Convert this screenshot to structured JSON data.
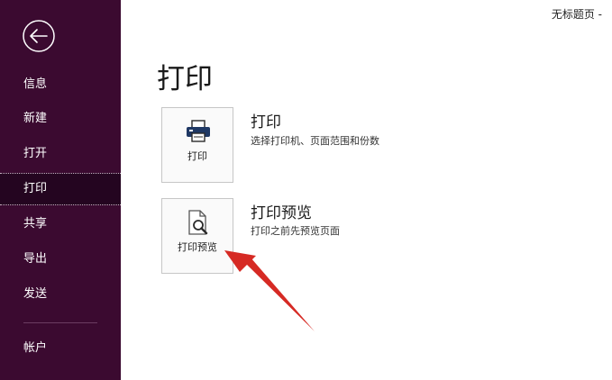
{
  "window": {
    "doc_title": "无标题页 -"
  },
  "sidebar": {
    "items": [
      {
        "label": "信息"
      },
      {
        "label": "新建"
      },
      {
        "label": "打开"
      },
      {
        "label": "打印"
      },
      {
        "label": "共享"
      },
      {
        "label": "导出"
      },
      {
        "label": "发送"
      },
      {
        "label": "帐户"
      }
    ],
    "active": "打印"
  },
  "main": {
    "title": "打印",
    "options": [
      {
        "button_label": "打印",
        "title": "打印",
        "description": "选择打印机、页面范围和份数",
        "icon": "printer-icon"
      },
      {
        "button_label": "打印预览",
        "title": "打印预览",
        "description": "打印之前先预览页面",
        "icon": "print-preview-icon"
      }
    ]
  },
  "colors": {
    "sidebar_bg": "#3b0a30",
    "sidebar_active_bg": "#240520",
    "arrow": "#d62a24"
  }
}
